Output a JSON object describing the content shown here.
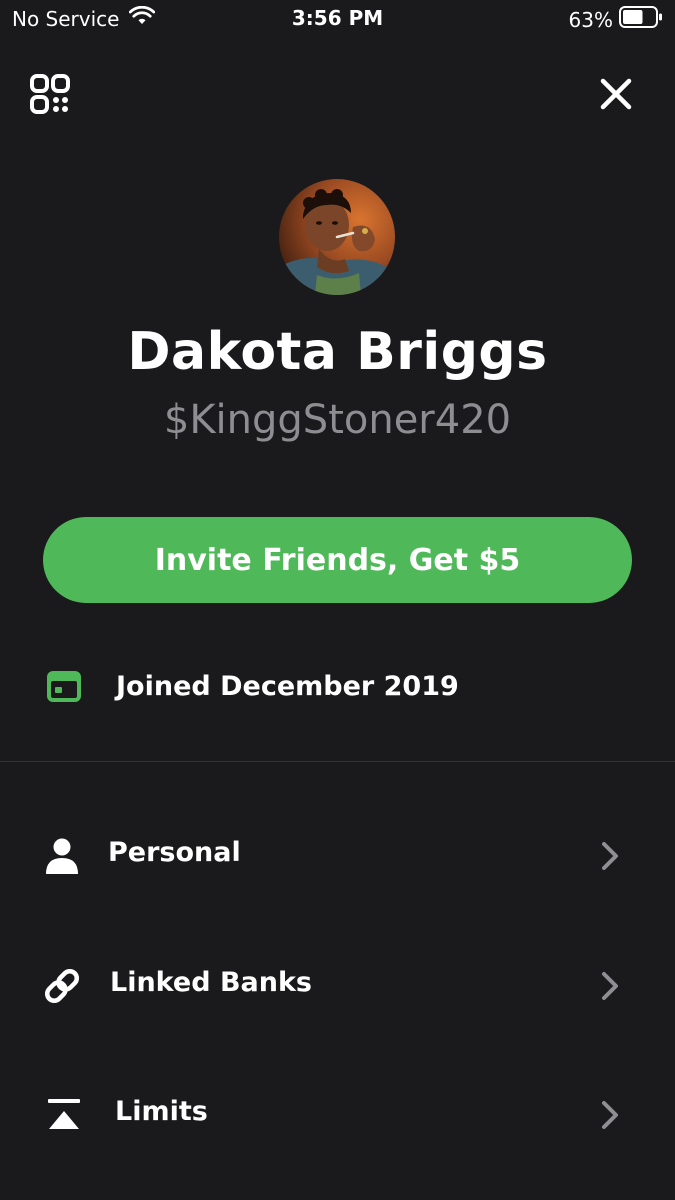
{
  "status_bar": {
    "carrier": "No Service",
    "time": "3:56 PM",
    "battery": "63%",
    "battery_level": 0.63
  },
  "profile": {
    "name": "Dakota Briggs",
    "cashtag": "$KinggStoner420"
  },
  "invite_button": {
    "label": "Invite Friends, Get $5"
  },
  "joined": {
    "text": "Joined December 2019"
  },
  "menu": {
    "items": [
      {
        "label": "Personal",
        "icon": "person-icon"
      },
      {
        "label": "Linked Banks",
        "icon": "link-icon"
      },
      {
        "label": "Limits",
        "icon": "limits-icon"
      }
    ]
  },
  "colors": {
    "background": "#1a1a1c",
    "accent": "#4fb858",
    "secondary_text": "#8d8d92",
    "chevron": "#8e8e93"
  }
}
